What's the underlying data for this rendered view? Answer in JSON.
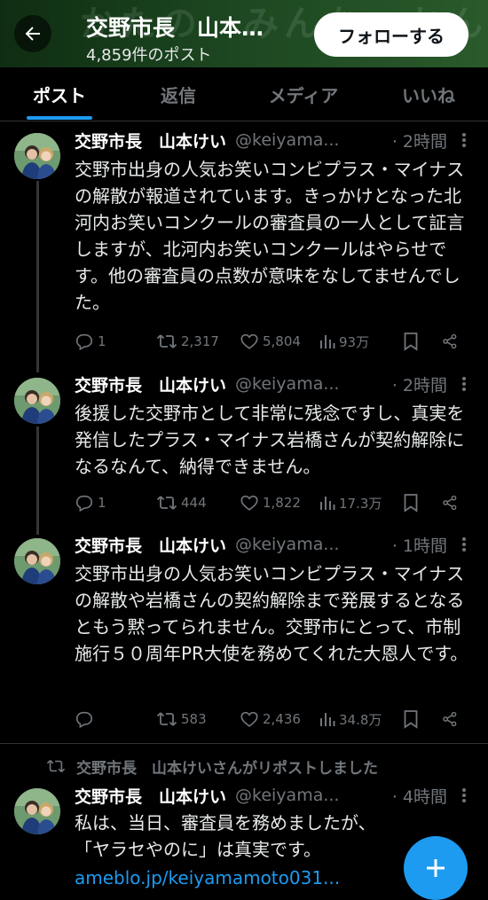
{
  "header": {
    "title": "交野市長　山本…",
    "post_count": "4,859件のポスト",
    "follow_label": "フォローする",
    "bg_text": "かたの　みんな　かんぱい"
  },
  "tabs": [
    {
      "label": "ポスト",
      "active": true
    },
    {
      "label": "返信",
      "active": false
    },
    {
      "label": "メディア",
      "active": false
    },
    {
      "label": "いいね",
      "active": false
    }
  ],
  "tweets": [
    {
      "name": "交野市長　山本けい",
      "handle": "@keiyama...",
      "time": "· 2時間",
      "text": "交野市出身の人気お笑いコンビプラス・マイナスの解散が報道されています。きっかけとなった北河内お笑いコンクールの審査員の一人として証言しますが、北河内お笑いコンクールはやらせです。他の審査員の点数が意味をなしてませんでした。",
      "reply": "1",
      "retweet": "2,317",
      "like": "5,804",
      "views": "93万"
    },
    {
      "name": "交野市長　山本けい",
      "handle": "@keiyama...",
      "time": "· 2時間",
      "text": "後援した交野市として非常に残念ですし、真実を発信したプラス・マイナス岩橋さんが契約解除になるなんて、納得できません。",
      "reply": "1",
      "retweet": "444",
      "like": "1,822",
      "views": "17.3万"
    },
    {
      "name": "交野市長　山本けい",
      "handle": "@keiyama...",
      "time": "· 1時間",
      "text": "交野市出身の人気お笑いコンビプラス・マイナスの解散や岩橋さんの契約解除まで発展するとなるともう黙ってられません。交野市にとって、市制施行５０周年PR大使を務めてくれた大恩人です。",
      "reply": "",
      "retweet": "583",
      "like": "2,436",
      "views": "34.8万"
    },
    {
      "repost_label": "交野市長　山本けいさんがリポストしました",
      "name": "交野市長　山本けい",
      "handle": "@keiyama...",
      "time": "· 4時間",
      "text": "私は、当日、審査員を務めましたが、「ヤラセやのに」は真実です。",
      "link": "ameblo.jp/keiyamamoto031..."
    }
  ],
  "colors": {
    "accent": "#1d9bf0",
    "background": "#000000",
    "muted": "#71767b",
    "text": "#e7e9ea",
    "header_green": "#1c4620"
  },
  "icons": {
    "back": "arrow-left-icon",
    "reply": "reply-bubble-icon",
    "retweet": "retweet-icon",
    "like": "heart-icon",
    "views": "bar-chart-icon",
    "bookmark": "bookmark-icon",
    "share": "share-icon",
    "more": "more-vertical-icon",
    "fab": "plus-icon"
  }
}
